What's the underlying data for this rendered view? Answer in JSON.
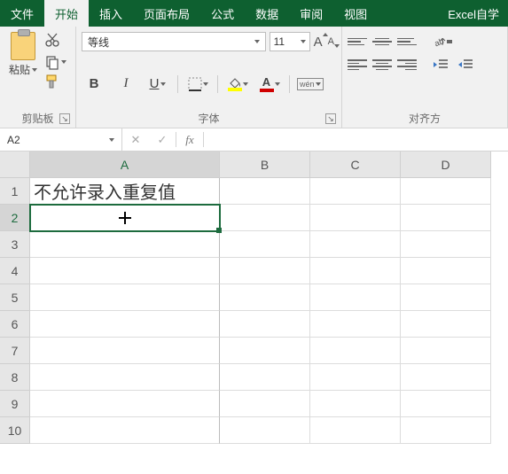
{
  "tabs": {
    "file": "文件",
    "home": "开始",
    "insert": "插入",
    "layout": "页面布局",
    "formula": "公式",
    "data": "数据",
    "review": "审阅",
    "view": "视图",
    "extra": "Excel自学"
  },
  "ribbon": {
    "clipboard": {
      "paste": "粘贴",
      "label": "剪贴板"
    },
    "font": {
      "name": "等线",
      "size": "11",
      "bigA": "A",
      "smallA": "A",
      "b": "B",
      "i": "I",
      "u": "U",
      "fontcolor_letter": "A",
      "wen": "wén",
      "label": "字体"
    },
    "align": {
      "label": "对齐方"
    }
  },
  "fbar": {
    "name": "A2",
    "cancel": "✕",
    "confirm": "✓",
    "fx": "fx",
    "formula": ""
  },
  "sheet": {
    "cols": [
      "A",
      "B",
      "C",
      "D"
    ],
    "rows": [
      "1",
      "2",
      "3",
      "4",
      "5",
      "6",
      "7",
      "8",
      "9",
      "10"
    ],
    "A1": "不允许录入重复值"
  }
}
